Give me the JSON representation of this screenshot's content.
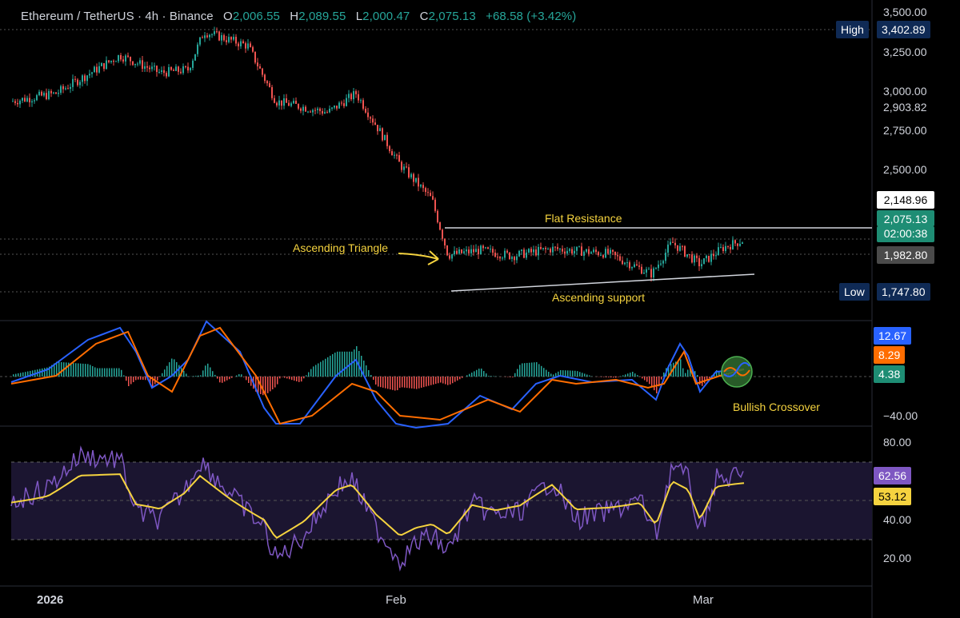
{
  "header": {
    "symbol": "Ethereum / TetherUS · 4h · Binance",
    "open_key": "O",
    "open": "2,006.55",
    "high_key": "H",
    "high": "2,089.55",
    "low_key": "L",
    "low": "2,000.47",
    "close_key": "C",
    "close": "2,075.13",
    "change": "+68.58 (+3.42%)"
  },
  "price_axis": {
    "ticks": [
      "3,500.00",
      "3,250.00",
      "3,000.00",
      "2,750.00",
      "2,500.00"
    ],
    "high_label": "High",
    "high_value": "3,402.89",
    "low_label": "Low",
    "low_value": "1,747.80",
    "mark_2903": "2,903.82",
    "mark_2148": "2,148.96",
    "last_price": "2,075.13",
    "countdown": "02:00:38",
    "mark_1982": "1,982.80"
  },
  "macd_axis": {
    "histogram": "12.67",
    "signal": "8.29",
    "macd": "4.38",
    "min_tick": "−40.00"
  },
  "rsi_axis": {
    "ticks": [
      "80.00",
      "40.00",
      "20.00"
    ],
    "rsi": "62.56",
    "rsi_ma": "53.12"
  },
  "annotations": {
    "flat_resistance": "Flat Resistance",
    "ascending_triangle": "Ascending Triangle",
    "ascending_support": "Ascending support",
    "bullish_crossover": "Bullish Crossover"
  },
  "time_axis": {
    "labels": [
      "2026",
      "Feb",
      "Mar"
    ]
  },
  "colors": {
    "up": "#26a69a",
    "down": "#ef5350",
    "macd": "#2962ff",
    "signal": "#ff6d00",
    "rsi": "#7e57c2",
    "rsi_ma": "#f5d33f",
    "annotation": "#f5d33f"
  },
  "chart_data": {
    "type": "line",
    "title": "",
    "series": [
      {
        "name": "ETHUSDT close",
        "x": [
          "2026-01-01",
          "2026-01-04",
          "2026-01-07",
          "2026-01-10",
          "2026-01-13",
          "2026-01-16",
          "2026-01-19",
          "2026-01-22",
          "2026-01-25",
          "2026-01-28",
          "2026-01-31",
          "2026-02-03",
          "2026-02-06",
          "2026-02-09",
          "2026-02-12",
          "2026-02-15",
          "2026-02-18",
          "2026-02-21",
          "2026-02-24",
          "2026-02-27",
          "2026-03-02",
          "2026-03-04"
        ],
        "values": [
          2950,
          3080,
          3240,
          3120,
          3140,
          3390,
          3300,
          2950,
          2860,
          3000,
          2700,
          2500,
          2200,
          1980,
          2040,
          2000,
          1990,
          1960,
          1850,
          2060,
          1950,
          2075
        ]
      }
    ],
    "ylabel": "",
    "xlabel": ""
  }
}
